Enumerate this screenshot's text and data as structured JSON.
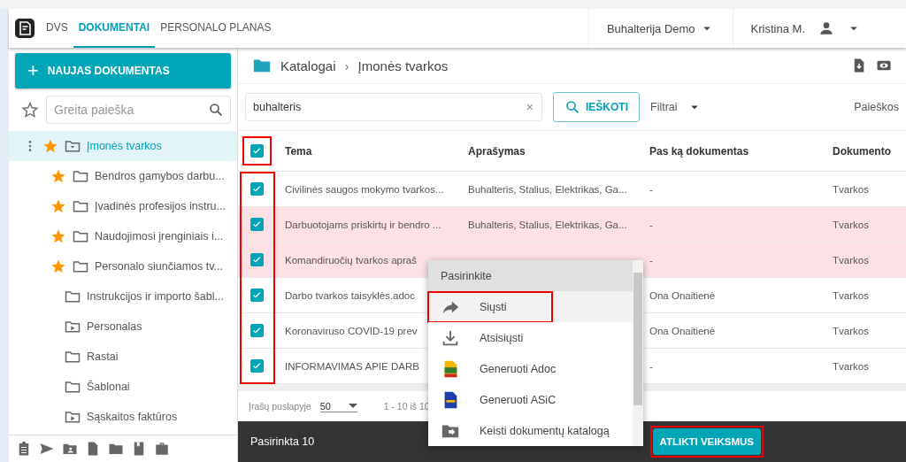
{
  "header": {
    "tabs": [
      {
        "label": "DVS",
        "selected": false
      },
      {
        "label": "DOKUMENTAI",
        "selected": true
      },
      {
        "label": "PERSONALO PLANAS",
        "selected": false
      }
    ],
    "company": "Buhalterija Demo",
    "user": "Kristina M."
  },
  "sidebar": {
    "new_button_icon": "+",
    "new_button": "NAUJAS DOKUMENTAS",
    "search": {
      "placeholder": "Greita paieška"
    },
    "items": [
      {
        "label": "Įmonės tvarkos",
        "starred": true,
        "selected": true,
        "kind": "inbox-folder"
      },
      {
        "label": "Bendros gamybos darbu...",
        "starred": true,
        "selected": false,
        "kind": "folder"
      },
      {
        "label": "Įvadinės profesijos instru...",
        "starred": true,
        "selected": false,
        "kind": "folder"
      },
      {
        "label": "Naudojimosi įrenginiais i...",
        "starred": true,
        "selected": false,
        "kind": "folder"
      },
      {
        "label": "Personalo siunčiamos tv...",
        "starred": true,
        "selected": false,
        "kind": "folder"
      },
      {
        "label": "Instrukcijos ir importo šabl...",
        "starred": false,
        "selected": false,
        "kind": "folder"
      },
      {
        "label": "Personalas",
        "starred": false,
        "selected": false,
        "kind": "play-folder"
      },
      {
        "label": "Rastai",
        "starred": false,
        "selected": false,
        "kind": "folder"
      },
      {
        "label": "Šablonai",
        "starred": false,
        "selected": false,
        "kind": "folder"
      },
      {
        "label": "Sąskaitos faktūros",
        "starred": false,
        "selected": false,
        "kind": "play-folder"
      }
    ]
  },
  "breadcrumb": [
    "Katalogai",
    "Įmonės tvarkos"
  ],
  "breadcrumb_separator": "›",
  "search": {
    "value": "buhalteris",
    "clear": "×",
    "button": "IEŠKOTI",
    "filters": "Filtrai",
    "saved": "Paieškos"
  },
  "table": {
    "annotated": true,
    "all_checked": true,
    "all_annotated": true,
    "columns": [
      "Tema",
      "Aprašymas",
      "Pas ką dokumentas",
      "Dokumento"
    ],
    "rows": [
      {
        "checked": true,
        "marked": false,
        "cells": [
          "Civilinės saugos mokymo tvarkos...",
          "Buhalteris, Stalius, Elektrikas, Ga...",
          "-",
          "Tvarkos"
        ]
      },
      {
        "checked": true,
        "marked": true,
        "cells": [
          "Darbuotojams priskirtų ir bendro ...",
          "Buhalteris, Stalius, Elektrikas, Ga...",
          "-",
          "Tvarkos"
        ]
      },
      {
        "checked": true,
        "marked": true,
        "cells": [
          "Komandiruočių tvarkos apraš",
          null,
          "-",
          "Tvarkos"
        ]
      },
      {
        "checked": true,
        "marked": false,
        "cells": [
          "Darbo tvarkos taisyklės.adoc",
          null,
          "Ona Onaitienė",
          "Tvarkos"
        ]
      },
      {
        "checked": true,
        "marked": false,
        "cells": [
          "Koronaviruso COVID-19 prev",
          null,
          "Ona Onaitienė",
          "Tvarkos"
        ]
      },
      {
        "checked": true,
        "marked": false,
        "cells": [
          "INFORMAVIMAS APIE DARB",
          null,
          "-",
          "Tvarkos"
        ]
      }
    ]
  },
  "pagination": {
    "label": "Įrašų puslapyje",
    "per_page": "50",
    "range": "1 - 10 iš 10"
  },
  "footer": {
    "selected_count": "Pasirinkta 10",
    "action_button": "ATLIKTI VEIKSMUS",
    "action_annotated": true
  },
  "menu": {
    "title": "Pasirinkite",
    "items": [
      {
        "label": "Siųsti",
        "kind": "share",
        "selected": true,
        "annotated": true
      },
      {
        "label": "Atsisiųsti",
        "kind": "download",
        "selected": false,
        "annotated": false
      },
      {
        "label": "Generuoti Adoc",
        "kind": "adoc",
        "selected": false,
        "annotated": false
      },
      {
        "label": "Generuoti ASiC",
        "kind": "asic",
        "selected": false,
        "annotated": false
      },
      {
        "label": "Keisti dokumentų katalogą",
        "kind": "move",
        "selected": false,
        "annotated": false
      }
    ]
  }
}
